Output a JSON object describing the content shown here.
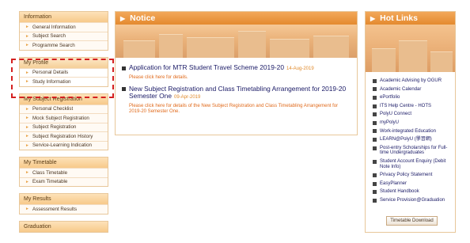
{
  "sidebar": {
    "groups": [
      {
        "title": "Information",
        "items": [
          "General Information",
          "Subject Search",
          "Programme Search"
        ]
      },
      {
        "title": "My Profile",
        "items": [
          "Personal Details",
          "Study Information"
        ]
      },
      {
        "title": "My Subject Registration",
        "items": [
          "Personal Checklist",
          "Mock Subject Registration",
          "Subject Registration",
          "Subject Registration History",
          "Service-Learning Indication"
        ]
      },
      {
        "title": "My Timetable",
        "items": [
          "Class Timetable",
          "Exam Timetable"
        ]
      },
      {
        "title": "My Results",
        "items": [
          "Assessment Results"
        ]
      },
      {
        "title": "Graduation",
        "items": []
      }
    ]
  },
  "notice": {
    "title": "Notice",
    "items": [
      {
        "title": "Application for MTR Student Travel Scheme 2019-20",
        "date": "14-Aug-2019",
        "desc": "Please click here for details."
      },
      {
        "title": "New Subject Registration and Class Timetabling Arrangement for 2019-20 Semester One",
        "date": "09-Apr-2019",
        "desc": "Please click here for details of the New Subject Registration and Class Timetabling Arrangement for 2019-20 Semester One."
      }
    ]
  },
  "hotlinks": {
    "title": "Hot Links",
    "items": [
      "Academic Advising by OGUR",
      "Academic Calendar",
      "ePortfolio",
      "ITS Help Centre - HOTS",
      "PolyU Connect",
      "myPolyU",
      "Work-integrated Education",
      "LEARN@PolyU (學習網)",
      "Post-entry Scholarships for Full-time Undergraduates",
      "Student Account Enquiry (Debit Note Info)",
      "Privacy Policy Statement",
      "EasyPlanner",
      "Student Handbook",
      "Service Provision@Graduation"
    ],
    "timetable_button": "Timetable Download"
  },
  "colors": {
    "accent": "#e48a2f",
    "highlight": "#d42020",
    "link": "#1a1a66"
  }
}
